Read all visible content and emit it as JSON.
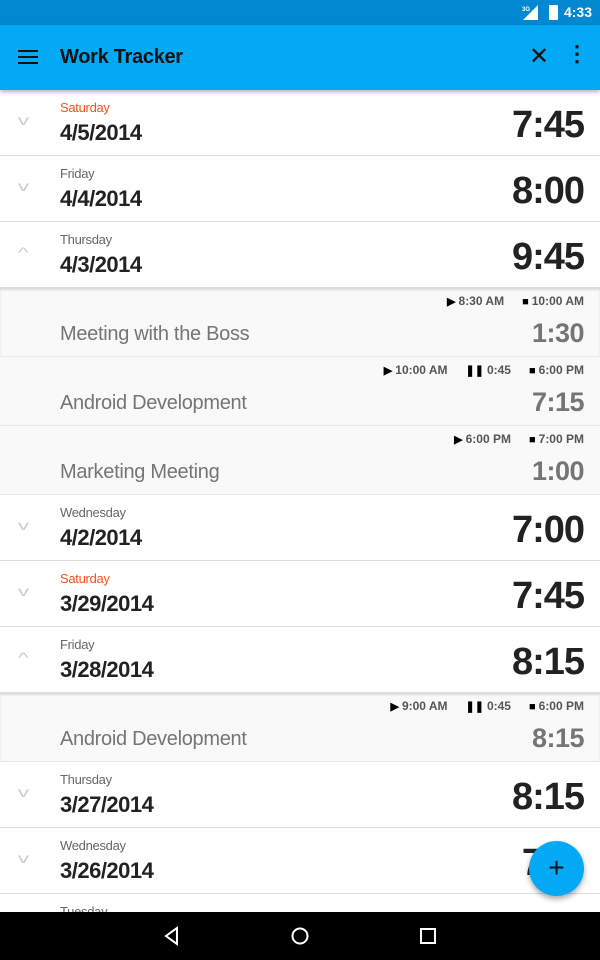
{
  "status_bar": {
    "network": "3G",
    "time": "4:33"
  },
  "app_bar": {
    "title": "Work Tracker",
    "icons": [
      "menu-icon",
      "close-icon",
      "more-vert-icon"
    ]
  },
  "colors": {
    "primary": "#03a9f4",
    "primary_dark": "#0288d1",
    "weekend": "#f4511e"
  },
  "rows": [
    {
      "type": "day",
      "weekday": "Saturday",
      "weekend": true,
      "date": "4/5/2014",
      "total": "7:45",
      "expanded": false
    },
    {
      "type": "day",
      "weekday": "Friday",
      "date": "4/4/2014",
      "total": "8:00",
      "expanded": false
    },
    {
      "type": "day",
      "weekday": "Thursday",
      "date": "4/3/2014",
      "total": "9:45",
      "expanded": true
    },
    {
      "type": "task",
      "name": "Meeting with the Boss",
      "start": "8:30 AM",
      "pause": null,
      "end": "10:00 AM",
      "duration": "1:30"
    },
    {
      "type": "task",
      "name": "Android Development",
      "start": "10:00 AM",
      "pause": "0:45",
      "end": "6:00 PM",
      "duration": "7:15"
    },
    {
      "type": "task",
      "name": "Marketing Meeting",
      "start": "6:00 PM",
      "pause": null,
      "end": "7:00 PM",
      "duration": "1:00"
    },
    {
      "type": "day",
      "weekday": "Wednesday",
      "date": "4/2/2014",
      "total": "7:00",
      "expanded": false
    },
    {
      "type": "day",
      "weekday": "Saturday",
      "weekend": true,
      "date": "3/29/2014",
      "total": "7:45",
      "expanded": false
    },
    {
      "type": "day",
      "weekday": "Friday",
      "date": "3/28/2014",
      "total": "8:15",
      "expanded": true
    },
    {
      "type": "task",
      "name": "Android Development",
      "start": "9:00 AM",
      "pause": "0:45",
      "end": "6:00 PM",
      "duration": "8:15"
    },
    {
      "type": "day",
      "weekday": "Thursday",
      "date": "3/27/2014",
      "total": "8:15",
      "expanded": false
    },
    {
      "type": "day",
      "weekday": "Wednesday",
      "date": "3/26/2014",
      "total": "7",
      "expanded": false
    },
    {
      "type": "day",
      "weekday": "Tuesday",
      "date": "",
      "total": "",
      "expanded": false
    }
  ],
  "fab": {
    "label": "+"
  }
}
